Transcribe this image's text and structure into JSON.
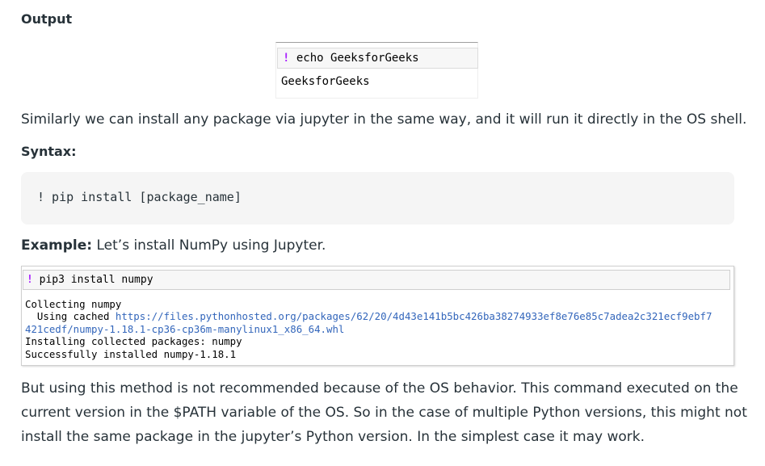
{
  "output_heading": "Output",
  "mini_notebook": {
    "bang": "!",
    "command": " echo GeeksforGeeks",
    "output": "GeeksforGeeks"
  },
  "para1": "Similarly we can install any package via jupyter in the same way, and it will run it directly in the OS shell.",
  "syntax_label": "Syntax:",
  "syntax_code": "! pip install [package_name]",
  "example_label": "Example:",
  "example_text": " Let’s install NumPy using Jupyter.",
  "notebook": {
    "bang": "!",
    "command": " pip3 install numpy",
    "output_lines": {
      "l1": "Collecting numpy",
      "l2_prefix": "  Using cached ",
      "l2_link": "https://files.pythonhosted.org/packages/62/20/4d43e141b5bc426ba38274933ef8e76e85c7adea2c321ecf9ebf7",
      "l3_link": "421cedf/numpy-1.18.1-cp36-cp36m-manylinux1_x86_64.whl",
      "l4": "Installing collected packages: numpy",
      "l5": "Successfully installed numpy-1.18.1"
    }
  },
  "last_para": {
    "line1": "But using this method is not recommended because of the OS behavior. This command executed on the",
    "line2": "current version in the $PATH variable of the OS. So in the case of multiple Python versions, this might not",
    "line3": "install the same package in the jupyter’s Python version. In the simplest case it may work."
  }
}
